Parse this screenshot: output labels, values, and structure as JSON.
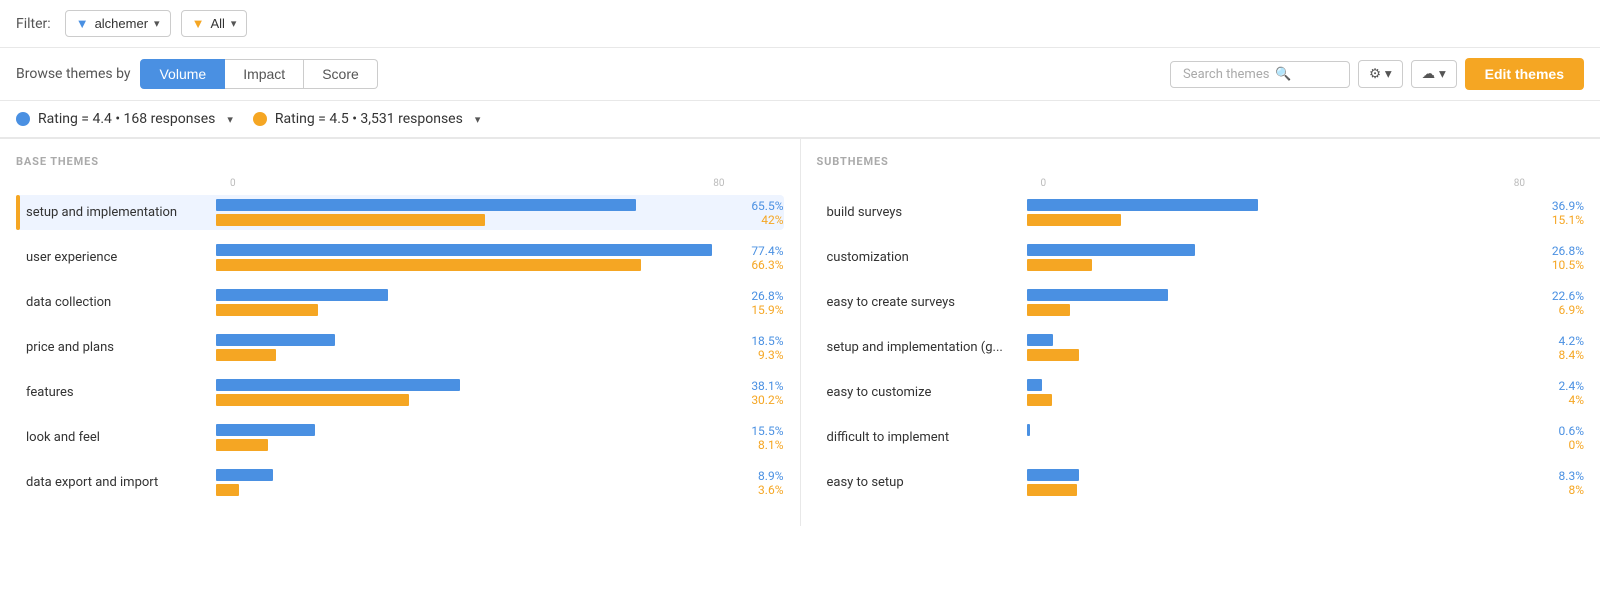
{
  "filter": {
    "label": "Filter:",
    "option1_label": "alchemer",
    "option2_label": "All"
  },
  "browse": {
    "label": "Browse themes by",
    "tabs": [
      "Volume",
      "Impact",
      "Score"
    ]
  },
  "search": {
    "placeholder": "Search themes"
  },
  "toolbar": {
    "edit_themes": "Edit themes"
  },
  "ratings": {
    "item1": "Rating = 4.4 • 168 responses",
    "item2": "Rating = 4.5 • 3,531 responses"
  },
  "base_themes": {
    "section_label": "BASE THEMES",
    "axis_start": "0",
    "axis_end": "80",
    "items": [
      {
        "name": "setup and implementation",
        "blue_pct": 65.5,
        "orange_pct": 42,
        "blue_label": "65.5%",
        "orange_label": "42%",
        "selected": true
      },
      {
        "name": "user experience",
        "blue_pct": 77.4,
        "orange_pct": 66.3,
        "blue_label": "77.4%",
        "orange_label": "66.3%",
        "selected": false
      },
      {
        "name": "data collection",
        "blue_pct": 26.8,
        "orange_pct": 15.9,
        "blue_label": "26.8%",
        "orange_label": "15.9%",
        "selected": false
      },
      {
        "name": "price and plans",
        "blue_pct": 18.5,
        "orange_pct": 9.3,
        "blue_label": "18.5%",
        "orange_label": "9.3%",
        "selected": false
      },
      {
        "name": "features",
        "blue_pct": 38.1,
        "orange_pct": 30.2,
        "blue_label": "38.1%",
        "orange_label": "30.2%",
        "selected": false
      },
      {
        "name": "look and feel",
        "blue_pct": 15.5,
        "orange_pct": 8.1,
        "blue_label": "15.5%",
        "orange_label": "8.1%",
        "selected": false
      },
      {
        "name": "data export and import",
        "blue_pct": 8.9,
        "orange_pct": 3.6,
        "blue_label": "8.9%",
        "orange_label": "3.6%",
        "selected": false
      }
    ]
  },
  "subthemes": {
    "section_label": "SUBTHEMES",
    "axis_start": "0",
    "axis_end": "80",
    "items": [
      {
        "name": "build surveys",
        "blue_pct": 36.9,
        "orange_pct": 15.1,
        "blue_label": "36.9%",
        "orange_label": "15.1%"
      },
      {
        "name": "customization",
        "blue_pct": 26.8,
        "orange_pct": 10.5,
        "blue_label": "26.8%",
        "orange_label": "10.5%"
      },
      {
        "name": "easy to create surveys",
        "blue_pct": 22.6,
        "orange_pct": 6.9,
        "blue_label": "22.6%",
        "orange_label": "6.9%"
      },
      {
        "name": "setup and implementation (g...",
        "blue_pct": 4.2,
        "orange_pct": 8.4,
        "blue_label": "4.2%",
        "orange_label": "8.4%"
      },
      {
        "name": "easy to customize",
        "blue_pct": 2.4,
        "orange_pct": 4,
        "blue_label": "2.4%",
        "orange_label": "4%"
      },
      {
        "name": "difficult to implement",
        "blue_pct": 0.6,
        "orange_pct": 0,
        "blue_label": "0.6%",
        "orange_label": "0%"
      },
      {
        "name": "easy to setup",
        "blue_pct": 8.3,
        "orange_pct": 8,
        "blue_label": "8.3%",
        "orange_label": "8%"
      }
    ]
  }
}
